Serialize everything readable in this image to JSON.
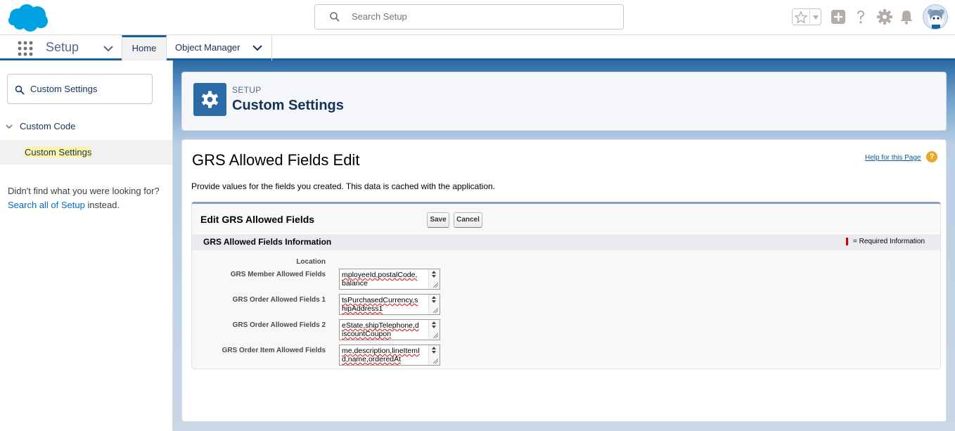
{
  "header": {
    "search_placeholder": "Search Setup",
    "brand_color": "#00a1e0"
  },
  "context_bar": {
    "app_name": "Setup",
    "tabs": [
      {
        "label": "Home"
      },
      {
        "label": "Object Manager"
      }
    ]
  },
  "sidebar": {
    "quick_find_value": "Custom Settings",
    "tree_parent": "Custom Code",
    "tree_child": "Custom Settings",
    "not_found_prefix": "Didn't find what you were looking for?",
    "not_found_link": "Search all of Setup",
    "not_found_suffix": "instead."
  },
  "page_header": {
    "eyebrow": "SETUP",
    "title": "Custom Settings"
  },
  "main": {
    "title": "GRS Allowed Fields Edit",
    "help_link": "Help for this Page",
    "description": "Provide values for the fields you created. This data is cached with the application.",
    "block_title": "Edit GRS Allowed Fields",
    "save_label": "Save",
    "cancel_label": "Cancel",
    "section_title": "GRS Allowed Fields Information",
    "required_text": "= Required Information",
    "fields": [
      {
        "label": "Location",
        "value": ""
      },
      {
        "label": "GRS Member Allowed Fields",
        "value_line1": "mployeeId,postalCode,",
        "value_line2": "balance"
      },
      {
        "label": "GRS Order Allowed Fields 1",
        "value_line1": "tsPurchasedCurrency,s",
        "value_line2": "hipAddress1"
      },
      {
        "label": "GRS Order Allowed Fields 2",
        "value_line1": "eState,shipTelephone,d",
        "value_line2": "iscountCoupon"
      },
      {
        "label": "GRS Order Item Allowed Fields",
        "value_line1": "me,description,lineItemI",
        "value_line2": "d,name,orderedAt"
      }
    ]
  }
}
